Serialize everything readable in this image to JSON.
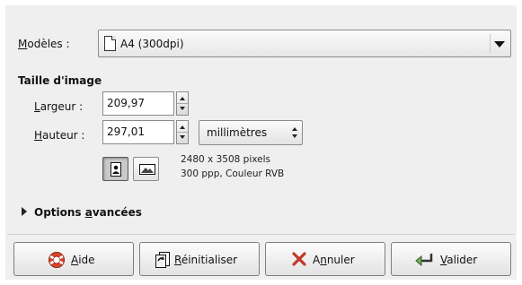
{
  "template": {
    "label_prefix": "",
    "label_mnemonic": "M",
    "label_rest": "odèles :",
    "selected": "A4 (300dpi)",
    "icon": "document-icon"
  },
  "image_size": {
    "title": "Taille d'image",
    "width": {
      "label_mnemonic": "L",
      "label_rest": "argeur :",
      "value": "209,97"
    },
    "height": {
      "label_mnemonic": "H",
      "label_rest": "auteur :",
      "value": "297,01"
    },
    "unit": "millimètres",
    "orientation": {
      "portrait_icon": "portrait-icon",
      "landscape_icon": "landscape-icon",
      "selected": "portrait"
    },
    "info_line1": "2480 x 3508 pixels",
    "info_line2": "300 ppp, Couleur RVB"
  },
  "advanced": {
    "pre": "Options ",
    "mnemonic": "a",
    "rest": "vancées"
  },
  "buttons": {
    "help": {
      "pre": "",
      "mnemonic": "A",
      "rest": "ide",
      "icon": "help-lifebuoy-icon"
    },
    "reset": {
      "pre": "",
      "mnemonic": "R",
      "rest": "éinitialiser",
      "icon": "reset-icon"
    },
    "cancel": {
      "pre": "A",
      "mnemonic": "n",
      "rest": "nuler",
      "icon": "cancel-x-icon"
    },
    "ok": {
      "pre": "",
      "mnemonic": "V",
      "rest": "alider",
      "icon": "ok-arrow-icon"
    }
  },
  "colors": {
    "background": "#efefef",
    "cancel_icon": "#c0392b",
    "help_icon": "#d9462a"
  }
}
